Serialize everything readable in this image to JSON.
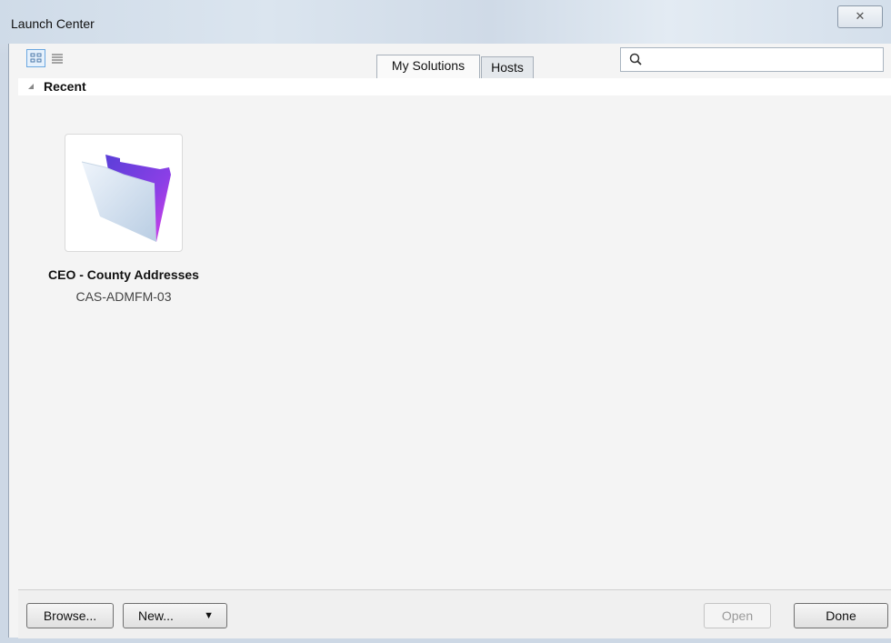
{
  "window": {
    "title": "Launch Center",
    "close_glyph": "✕"
  },
  "toolbar": {
    "view_grid_icon": "grid-view-icon",
    "view_list_icon": "list-view-icon",
    "tabs": [
      {
        "label": "My Solutions",
        "selected": true
      },
      {
        "label": "Hosts",
        "selected": false
      }
    ],
    "search": {
      "placeholder": "",
      "value": "",
      "icon": "search-icon"
    }
  },
  "section": {
    "label": "Recent"
  },
  "files": [
    {
      "name": "CEO - County Addresses",
      "host": "CAS-ADMFM-03",
      "icon": "filemaker-folder-icon"
    }
  ],
  "buttons": {
    "browse": "Browse...",
    "new": "New...",
    "new_caret": "▼",
    "open": "Open",
    "done": "Done"
  },
  "colors": {
    "accent": "#6aa7e0",
    "icon_purple": "#7b3fe0",
    "icon_magenta": "#d93de0"
  }
}
